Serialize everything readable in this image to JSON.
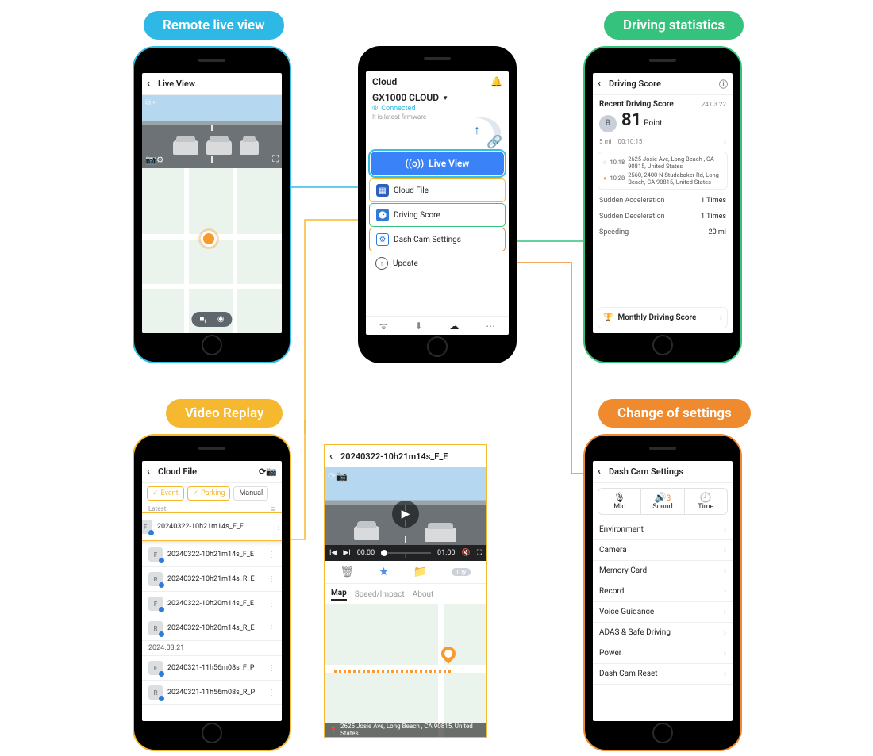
{
  "pills": {
    "remote_live_view": "Remote live view",
    "driving_stats": "Driving statistics",
    "video_replay": "Video Replay",
    "change_settings": "Change of settings"
  },
  "live_view": {
    "title": "Live View"
  },
  "cloud": {
    "title": "Cloud",
    "device": "GX1000 CLOUD",
    "connected": "Connected",
    "firmware": "It is latest firmware",
    "live_view_btn": "Live View",
    "menu": {
      "cloud_file": "Cloud File",
      "driving_score": "Driving Score",
      "settings": "Dash Cam Settings",
      "update": "Update"
    }
  },
  "score": {
    "title": "Driving Score",
    "recent_label": "Recent Driving Score",
    "date": "24.03.22",
    "grade": "B",
    "points": "81",
    "points_unit": "Point",
    "dist": "5 mi",
    "dur": "00:10:15",
    "trip_start_time": "10:18",
    "trip_start_addr": "2625 Josie Ave, Long Beach , CA 90815, United States",
    "trip_end_time": "10:28",
    "trip_end_addr": "2560, 2400 N Studebaker Rd, Long Beach, CA 90815, United States",
    "stats": {
      "accel_label": "Sudden Acceleration",
      "accel_val": "1 Times",
      "decel_label": "Sudden Deceleration",
      "decel_val": "1 Times",
      "speeding_label": "Speeding",
      "speeding_val": "20 mi"
    },
    "monthly": "Monthly Driving Score"
  },
  "cloud_file": {
    "title": "Cloud File",
    "filters": {
      "event": "Event",
      "parking": "Parking",
      "manual": "Manual"
    },
    "latest": "Latest",
    "date_header": "2024.03.21",
    "items": [
      "20240322-10h21m14s_F_E",
      "20240322-10h21m14s_F_E",
      "20240322-10h21m14s_R_E",
      "20240322-10h20m14s_F_E",
      "20240322-10h20m14s_R_E",
      "20240321-11h56m08s_F_P",
      "20240321-11h56m08s_R_P"
    ],
    "thumbs": [
      "F",
      "F",
      "R",
      "F",
      "R",
      "F",
      "R"
    ]
  },
  "replay": {
    "title": "20240322-10h21m14s_F_E",
    "time_cur": "00:00",
    "time_tot": "01:00",
    "tabs": {
      "map": "Map",
      "speed": "Speed/Impact",
      "about": "About"
    },
    "address": "2625 Josie Ave, Long Beach , CA 90815, United States"
  },
  "settings": {
    "title": "Dash Cam Settings",
    "seg": {
      "mic": "Mic",
      "sound": "Sound",
      "time": "Time",
      "sound_val": "3"
    },
    "rows": [
      "Environment",
      "Camera",
      "Memory Card",
      "Record",
      "Voice Guidance",
      "ADAS & Safe Driving",
      "Power",
      "Dash Cam Reset"
    ]
  }
}
